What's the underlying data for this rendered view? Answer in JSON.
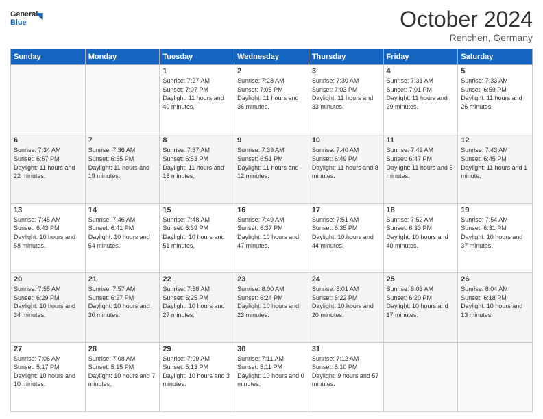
{
  "header": {
    "logo_general": "General",
    "logo_blue": "Blue",
    "month": "October 2024",
    "location": "Renchen, Germany"
  },
  "weekdays": [
    "Sunday",
    "Monday",
    "Tuesday",
    "Wednesday",
    "Thursday",
    "Friday",
    "Saturday"
  ],
  "weeks": [
    [
      {
        "day": "",
        "sunrise": "",
        "sunset": "",
        "daylight": ""
      },
      {
        "day": "",
        "sunrise": "",
        "sunset": "",
        "daylight": ""
      },
      {
        "day": "1",
        "sunrise": "Sunrise: 7:27 AM",
        "sunset": "Sunset: 7:07 PM",
        "daylight": "Daylight: 11 hours and 40 minutes."
      },
      {
        "day": "2",
        "sunrise": "Sunrise: 7:28 AM",
        "sunset": "Sunset: 7:05 PM",
        "daylight": "Daylight: 11 hours and 36 minutes."
      },
      {
        "day": "3",
        "sunrise": "Sunrise: 7:30 AM",
        "sunset": "Sunset: 7:03 PM",
        "daylight": "Daylight: 11 hours and 33 minutes."
      },
      {
        "day": "4",
        "sunrise": "Sunrise: 7:31 AM",
        "sunset": "Sunset: 7:01 PM",
        "daylight": "Daylight: 11 hours and 29 minutes."
      },
      {
        "day": "5",
        "sunrise": "Sunrise: 7:33 AM",
        "sunset": "Sunset: 6:59 PM",
        "daylight": "Daylight: 11 hours and 26 minutes."
      }
    ],
    [
      {
        "day": "6",
        "sunrise": "Sunrise: 7:34 AM",
        "sunset": "Sunset: 6:57 PM",
        "daylight": "Daylight: 11 hours and 22 minutes."
      },
      {
        "day": "7",
        "sunrise": "Sunrise: 7:36 AM",
        "sunset": "Sunset: 6:55 PM",
        "daylight": "Daylight: 11 hours and 19 minutes."
      },
      {
        "day": "8",
        "sunrise": "Sunrise: 7:37 AM",
        "sunset": "Sunset: 6:53 PM",
        "daylight": "Daylight: 11 hours and 15 minutes."
      },
      {
        "day": "9",
        "sunrise": "Sunrise: 7:39 AM",
        "sunset": "Sunset: 6:51 PM",
        "daylight": "Daylight: 11 hours and 12 minutes."
      },
      {
        "day": "10",
        "sunrise": "Sunrise: 7:40 AM",
        "sunset": "Sunset: 6:49 PM",
        "daylight": "Daylight: 11 hours and 8 minutes."
      },
      {
        "day": "11",
        "sunrise": "Sunrise: 7:42 AM",
        "sunset": "Sunset: 6:47 PM",
        "daylight": "Daylight: 11 hours and 5 minutes."
      },
      {
        "day": "12",
        "sunrise": "Sunrise: 7:43 AM",
        "sunset": "Sunset: 6:45 PM",
        "daylight": "Daylight: 11 hours and 1 minute."
      }
    ],
    [
      {
        "day": "13",
        "sunrise": "Sunrise: 7:45 AM",
        "sunset": "Sunset: 6:43 PM",
        "daylight": "Daylight: 10 hours and 58 minutes."
      },
      {
        "day": "14",
        "sunrise": "Sunrise: 7:46 AM",
        "sunset": "Sunset: 6:41 PM",
        "daylight": "Daylight: 10 hours and 54 minutes."
      },
      {
        "day": "15",
        "sunrise": "Sunrise: 7:48 AM",
        "sunset": "Sunset: 6:39 PM",
        "daylight": "Daylight: 10 hours and 51 minutes."
      },
      {
        "day": "16",
        "sunrise": "Sunrise: 7:49 AM",
        "sunset": "Sunset: 6:37 PM",
        "daylight": "Daylight: 10 hours and 47 minutes."
      },
      {
        "day": "17",
        "sunrise": "Sunrise: 7:51 AM",
        "sunset": "Sunset: 6:35 PM",
        "daylight": "Daylight: 10 hours and 44 minutes."
      },
      {
        "day": "18",
        "sunrise": "Sunrise: 7:52 AM",
        "sunset": "Sunset: 6:33 PM",
        "daylight": "Daylight: 10 hours and 40 minutes."
      },
      {
        "day": "19",
        "sunrise": "Sunrise: 7:54 AM",
        "sunset": "Sunset: 6:31 PM",
        "daylight": "Daylight: 10 hours and 37 minutes."
      }
    ],
    [
      {
        "day": "20",
        "sunrise": "Sunrise: 7:55 AM",
        "sunset": "Sunset: 6:29 PM",
        "daylight": "Daylight: 10 hours and 34 minutes."
      },
      {
        "day": "21",
        "sunrise": "Sunrise: 7:57 AM",
        "sunset": "Sunset: 6:27 PM",
        "daylight": "Daylight: 10 hours and 30 minutes."
      },
      {
        "day": "22",
        "sunrise": "Sunrise: 7:58 AM",
        "sunset": "Sunset: 6:25 PM",
        "daylight": "Daylight: 10 hours and 27 minutes."
      },
      {
        "day": "23",
        "sunrise": "Sunrise: 8:00 AM",
        "sunset": "Sunset: 6:24 PM",
        "daylight": "Daylight: 10 hours and 23 minutes."
      },
      {
        "day": "24",
        "sunrise": "Sunrise: 8:01 AM",
        "sunset": "Sunset: 6:22 PM",
        "daylight": "Daylight: 10 hours and 20 minutes."
      },
      {
        "day": "25",
        "sunrise": "Sunrise: 8:03 AM",
        "sunset": "Sunset: 6:20 PM",
        "daylight": "Daylight: 10 hours and 17 minutes."
      },
      {
        "day": "26",
        "sunrise": "Sunrise: 8:04 AM",
        "sunset": "Sunset: 6:18 PM",
        "daylight": "Daylight: 10 hours and 13 minutes."
      }
    ],
    [
      {
        "day": "27",
        "sunrise": "Sunrise: 7:06 AM",
        "sunset": "Sunset: 5:17 PM",
        "daylight": "Daylight: 10 hours and 10 minutes."
      },
      {
        "day": "28",
        "sunrise": "Sunrise: 7:08 AM",
        "sunset": "Sunset: 5:15 PM",
        "daylight": "Daylight: 10 hours and 7 minutes."
      },
      {
        "day": "29",
        "sunrise": "Sunrise: 7:09 AM",
        "sunset": "Sunset: 5:13 PM",
        "daylight": "Daylight: 10 hours and 3 minutes."
      },
      {
        "day": "30",
        "sunrise": "Sunrise: 7:11 AM",
        "sunset": "Sunset: 5:11 PM",
        "daylight": "Daylight: 10 hours and 0 minutes."
      },
      {
        "day": "31",
        "sunrise": "Sunrise: 7:12 AM",
        "sunset": "Sunset: 5:10 PM",
        "daylight": "Daylight: 9 hours and 57 minutes."
      },
      {
        "day": "",
        "sunrise": "",
        "sunset": "",
        "daylight": ""
      },
      {
        "day": "",
        "sunrise": "",
        "sunset": "",
        "daylight": ""
      }
    ]
  ]
}
